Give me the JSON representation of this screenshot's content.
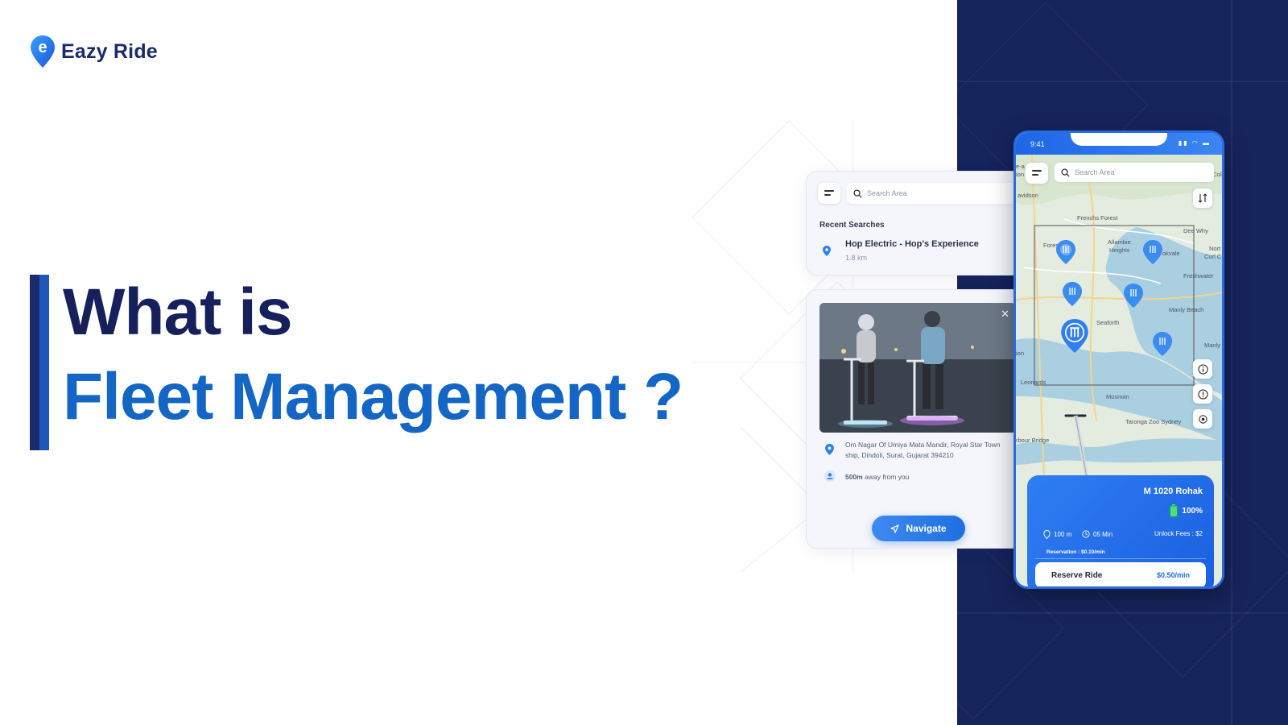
{
  "brand": {
    "name": "Eazy Ride",
    "logo_letter": "e"
  },
  "heading": {
    "line1": "What is",
    "line2": "Fleet Management ?"
  },
  "colors": {
    "navy": "#16245c",
    "brand_blue": "#1466c4",
    "heading_dark": "#16205a",
    "accent_button": "#1f6fe0"
  },
  "search_panel": {
    "search_placeholder": "Search Area",
    "recent_title": "Recent Searches",
    "recent_items": [
      {
        "name": "Hop Electric - Hop's Experience",
        "distance": "1.8 km"
      }
    ]
  },
  "detail_panel": {
    "address": "Om Nagar Of Umiya Mata Mandir, Royal Star Town ship, Dindoli, Surat, Gujarat 394210",
    "distance_bold": "500m",
    "distance_rest": " away from you",
    "navigate_label": "Navigate"
  },
  "phone": {
    "time": "9:41",
    "search_placeholder": "Search Area",
    "map_labels": [
      "avidson",
      "Frenchs Forest",
      "Dee Why",
      "Fores",
      "Allambie",
      "Heights",
      "okvale",
      "Nort",
      "Curl C",
      "Freshwater",
      "Manly Beach",
      "Seaforth",
      "Manly",
      "ion",
      "Leonards",
      "Mosman",
      "Taronga Zoo Sydney",
      "rbour Bridge",
      "e-a",
      "ion",
      "Coll"
    ],
    "ride": {
      "name": "M 1020 Rohak",
      "battery": "100%",
      "distance": "100 m",
      "time": "05 Min",
      "unlock_fees": "Unlock Fees : $2",
      "reservation": "Reservation : $0.10/min",
      "reserve_label": "Reserve Ride",
      "price": "$0.50/min"
    }
  }
}
